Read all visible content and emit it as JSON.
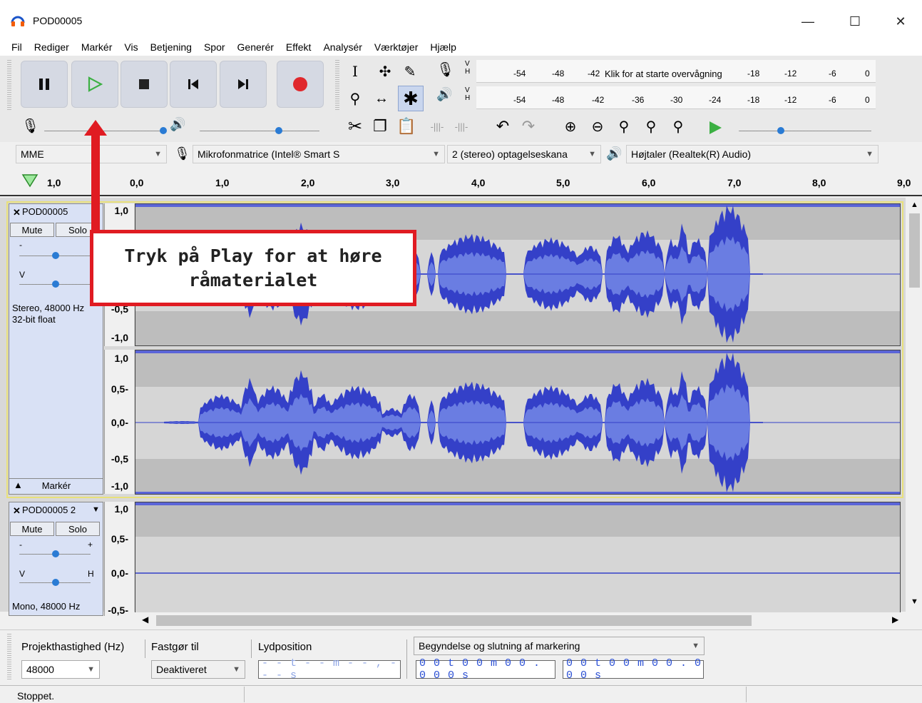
{
  "window": {
    "title": "POD00005",
    "minimize": "—",
    "maximize": "☐",
    "close": "✕"
  },
  "menu": [
    "Fil",
    "Rediger",
    "Markér",
    "Vis",
    "Betjening",
    "Spor",
    "Generér",
    "Effekt",
    "Analysér",
    "Værktøjer",
    "Hjælp"
  ],
  "meter_rec": {
    "labels": [
      "-54",
      "-48",
      "-42",
      "-18",
      "-12",
      "-6",
      "0"
    ],
    "message": "Klik for at starte overvågning",
    "channel": "V H"
  },
  "meter_play": {
    "labels": [
      "-54",
      "-48",
      "-42",
      "-36",
      "-30",
      "-24",
      "-18",
      "-12",
      "-6",
      "0"
    ]
  },
  "device": {
    "host": "MME",
    "input": "Mikrofonmatrice (Intel® Smart S",
    "channels": "2 (stereo) optagelseskana",
    "output": "Højtaler (Realtek(R) Audio)"
  },
  "ruler": {
    "labels": [
      "1,0",
      "0,0",
      "1,0",
      "2,0",
      "3,0",
      "4,0",
      "5,0",
      "6,0",
      "7,0",
      "8,0",
      "9,0"
    ]
  },
  "track1": {
    "name": "POD00005",
    "mute": "Mute",
    "solo": "Solo",
    "gain_minus": "-",
    "gain_plus": "+",
    "pan_l": "V",
    "pan_r": "H",
    "info_rate": "Stereo, 48000 Hz",
    "info_fmt": "32-bit float",
    "select": "Markér",
    "scale_top": [
      "1,0",
      "-0,5",
      "-1,0"
    ],
    "scale_bottom": [
      "1,0",
      "0,5-",
      "0,0-",
      "-0,5",
      "-1,0"
    ]
  },
  "track2": {
    "name": "POD00005 2",
    "mute": "Mute",
    "solo": "Solo",
    "gain_minus": "-",
    "gain_plus": "+",
    "pan_l": "V",
    "pan_r": "H",
    "info_rate": "Mono, 48000 Hz",
    "scale": [
      "1,0",
      "0,5-",
      "0,0-",
      "-0,5-"
    ]
  },
  "bottom": {
    "rate_label": "Projekthastighed (Hz)",
    "rate_value": "48000",
    "snap_label": "Fastgør til",
    "snap_value": "Deaktiveret",
    "pos_label": "Lydposition",
    "pos_value": "- - t - - m - - , - - - s",
    "sel_label": "Begyndelse og slutning af markering",
    "sel_start": "0 0 t 0 0 m 0 0 . 0 0 0 s",
    "sel_end": "0 0 t 0 0 m 0 0 . 0 0 0 s"
  },
  "status": "Stoppet.",
  "annotation": {
    "text": "Tryk på Play for at høre råmaterialet"
  },
  "colors": {
    "wave": "#4a5ed6",
    "wave_dark": "#3440c8",
    "accent_red": "#e01b22",
    "play_green": "#3cb043",
    "record_red": "#e0282d"
  }
}
